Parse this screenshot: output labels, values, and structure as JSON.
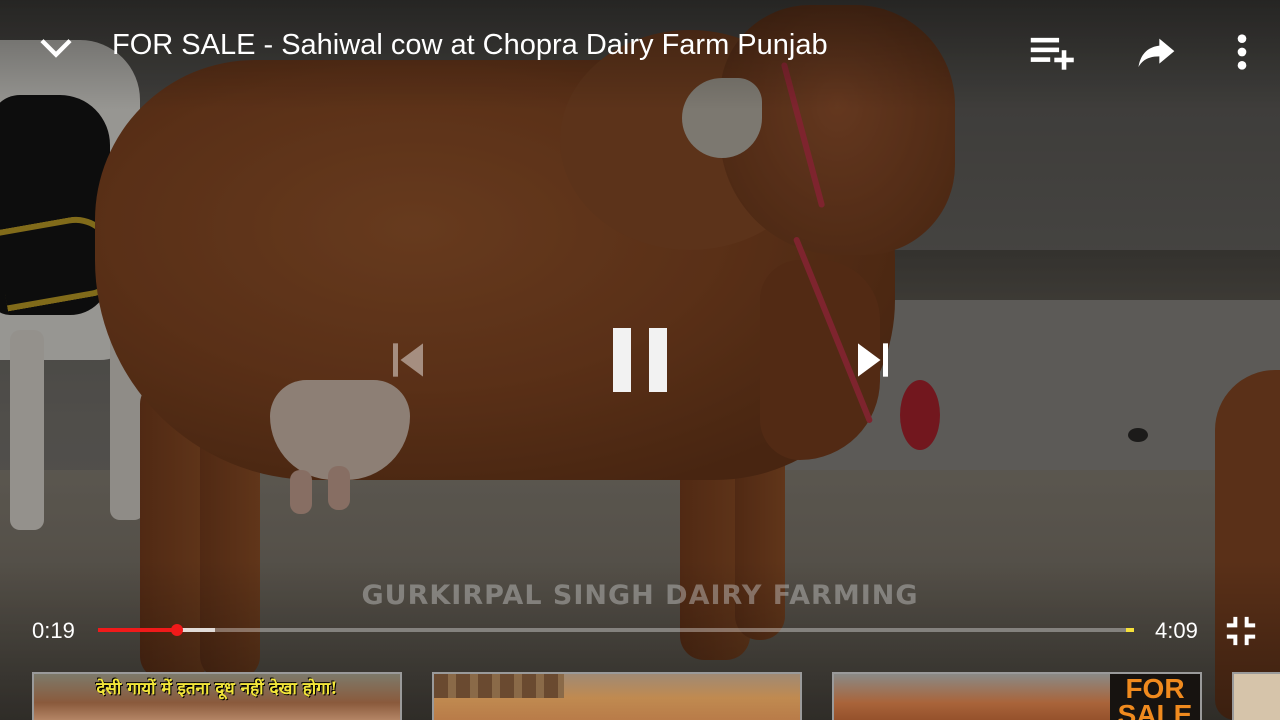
{
  "video": {
    "title": "FOR SALE - Sahiwal cow at Chopra Dairy Farm Punjab",
    "watermark": "GURKIRPAL SINGH DAIRY FARMING"
  },
  "topbar": {
    "icons": {
      "collapse": "chevron-down-icon",
      "add_to_queue": "playlist-add-icon",
      "share": "share-arrow-icon",
      "more": "more-vert-icon"
    }
  },
  "controls": {
    "state": "playing",
    "icons": {
      "previous": "skip-previous-icon",
      "pause": "pause-icon",
      "next": "skip-next-icon",
      "exit_fullscreen": "fullscreen-exit-icon"
    },
    "previous_enabled": false
  },
  "progress": {
    "current_time": "0:19",
    "total_time": "4:09",
    "played_fraction": 0.0763,
    "buffered_fraction": 0.1129,
    "ad_marker_fraction": 0.992,
    "colors": {
      "played": "#f01a1a",
      "ad_marker": "#f5e03a"
    }
  },
  "suggestions": [
    {
      "caption": "देसी गायों में इतना दूध नहीं देखा होगा!"
    },
    {
      "caption": ""
    },
    {
      "badge_line1": "FOR",
      "badge_line2": "SALE"
    },
    {
      "caption": ""
    }
  ]
}
